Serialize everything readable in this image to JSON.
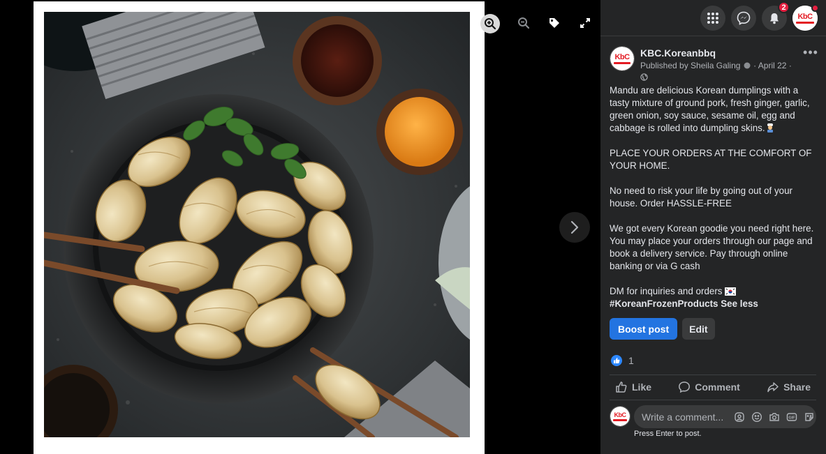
{
  "viewer": {
    "tools": [
      {
        "icon": "zoom-in-icon"
      },
      {
        "icon": "zoom-out-icon"
      },
      {
        "icon": "tag-icon"
      },
      {
        "icon": "fullscreen-icon"
      }
    ],
    "next_icon": "chevron-right-icon"
  },
  "topbar": {
    "icons": [
      "menu-grid-icon",
      "messenger-icon",
      "bell-icon",
      "profile-avatar"
    ],
    "notification_count": "2"
  },
  "post": {
    "logo_text": "KbC",
    "page_name": "KBC.Koreanbbq",
    "published_by": "Published by Sheila Galing",
    "date": "April 22",
    "separator": "·",
    "paragraphs": [
      "Mandu are delicious Korean dumplings with a tasty mixture of ground pork, fresh ginger, garlic, green onion, soy sauce, sesame oil, egg and cabbage is rolled into dumpling skins.",
      "PLACE YOUR ORDERS AT THE COMFORT OF YOUR HOME.",
      "No need to risk your life by going out of your house. Order HASSLE-FREE",
      "We got every Korean goodie you need right here. You may place your orders through our page and book a delivery service. Pay through online banking or via G cash",
      "DM for inquiries and orders"
    ],
    "hashtag": "#KoreanFrozenProducts",
    "see_less": "See less",
    "boost_label": "Boost post",
    "edit_label": "Edit",
    "reaction_count": "1",
    "like_label": "Like",
    "comment_label": "Comment",
    "share_label": "Share",
    "comment_placeholder": "Write a comment...",
    "comment_hint": "Press Enter to post."
  },
  "colors": {
    "panel_bg": "#242526",
    "accent": "#2374e1",
    "badge": "#e41e3f",
    "text": "#e4e6eb",
    "muted": "#b0b3b8"
  }
}
